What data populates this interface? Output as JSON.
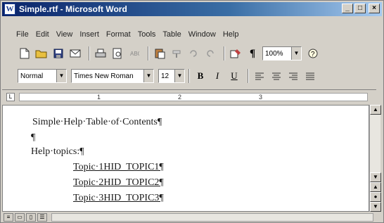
{
  "window": {
    "title": "Simple.rtf - Microsoft Word",
    "minimize": "_",
    "maximize": "□",
    "close": "×"
  },
  "menu": [
    "File",
    "Edit",
    "View",
    "Insert",
    "Format",
    "Tools",
    "Table",
    "Window",
    "Help"
  ],
  "toolbar": {
    "zoom": "100%",
    "style": "Normal",
    "font": "Times New Roman",
    "size": "12"
  },
  "ruler": {
    "marks": [
      "1",
      "2",
      "3"
    ]
  },
  "document": {
    "heading": "Simple·Help·Table·of·Contents¶",
    "blank": "¶",
    "topics_label": "Help·topics:¶",
    "topics": [
      "Topic·1HID_TOPIC1¶",
      "Topic·2HID_TOPIC2¶",
      "Topic·3HID_TOPIC3¶"
    ]
  }
}
